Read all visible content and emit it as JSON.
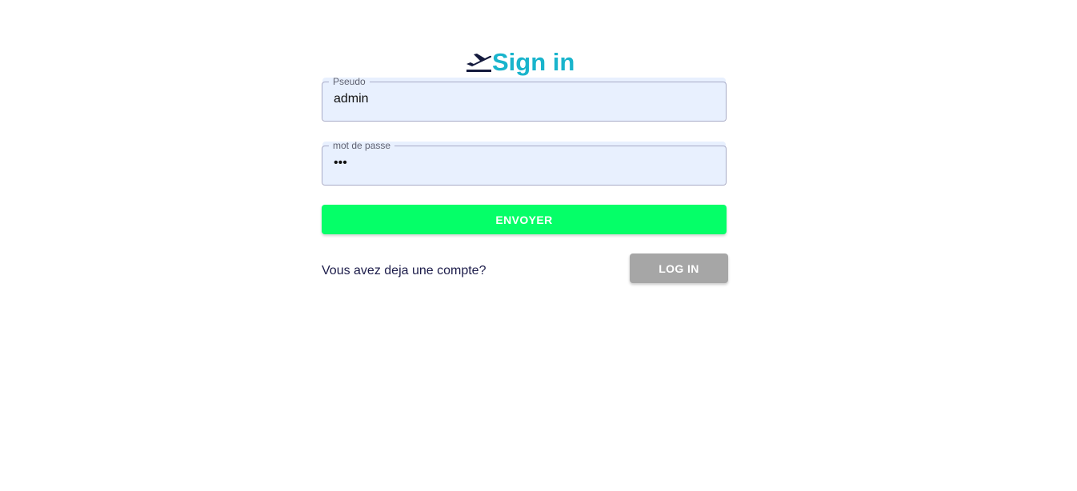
{
  "header": {
    "title": "Sign in",
    "icon": "airplane-takeoff-icon"
  },
  "form": {
    "pseudo": {
      "label": "Pseudo",
      "value": "admin"
    },
    "password": {
      "label": "mot de passe",
      "value": "***"
    },
    "submit_label": "ENVOYER"
  },
  "footer": {
    "prompt": "Vous avez deja une compte?",
    "login_label": "LOG IN"
  },
  "colors": {
    "title": "#19b4cc",
    "icon": "#141a3d",
    "submit_bg": "#05ff68",
    "login_bg": "#a6a6a6",
    "input_bg": "#e8f0fe"
  }
}
